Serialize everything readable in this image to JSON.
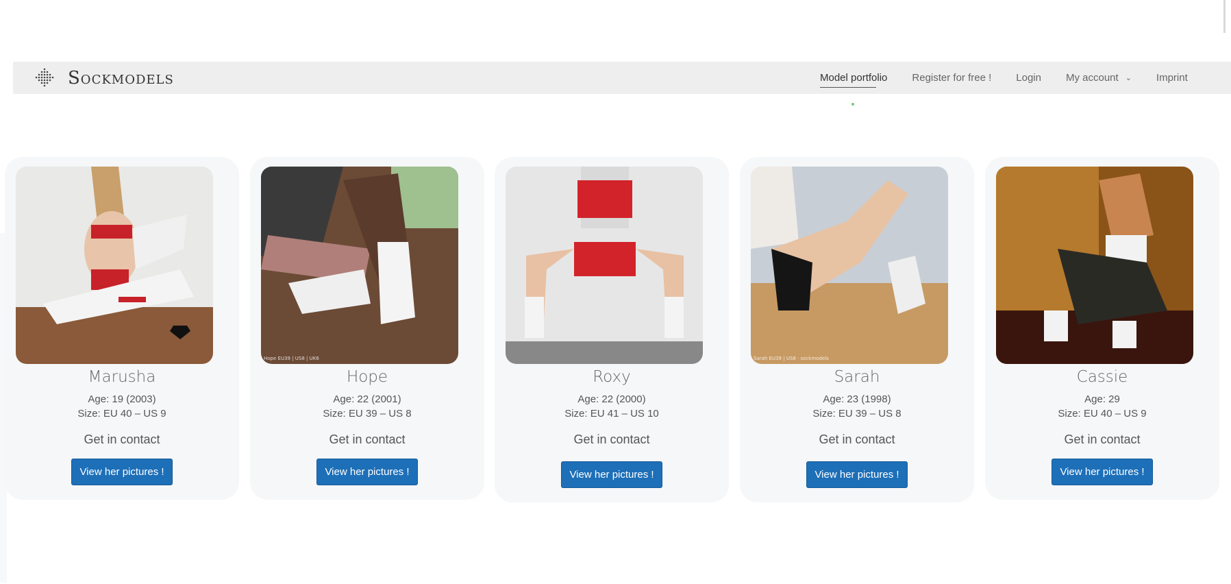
{
  "header": {
    "brand": "Sockmodels",
    "logo_icon": "diamond-dots-logo",
    "nav": [
      {
        "label": "Model portfolio",
        "active": true
      },
      {
        "label": "Register for free !"
      },
      {
        "label": "Login"
      },
      {
        "label": "My account",
        "icon": "chevron-down-icon"
      },
      {
        "label": "Imprint"
      }
    ]
  },
  "colors": {
    "navbar_bg": "#eeeeee",
    "card_bg": "#f5f7f8",
    "button_bg": "#1d6fb8",
    "button_text": "#ffffff"
  },
  "models": [
    {
      "name": "Marusha",
      "age": "Age: 19 (2003)",
      "size": "Size: EU 40 – US 9",
      "contact": "Get in contact",
      "button": "View her pictures !"
    },
    {
      "name": "Hope",
      "age": "Age: 22 (2001)",
      "size": "Size: EU 39 – US 8",
      "contact": "Get in contact",
      "button": "View her pictures !",
      "watermark": "Hope EU39 | US8 | UK6"
    },
    {
      "name": "Roxy",
      "age": "Age: 22 (2000)",
      "size": "Size: EU 41 – US 10",
      "contact": "Get in contact",
      "button": "View her pictures !"
    },
    {
      "name": "Sarah",
      "age": "Age: 23 (1998)",
      "size": "Size: EU 39 – US 8",
      "contact": "Get in contact",
      "button": "View her pictures !",
      "watermark": "Sarah EU39 | US8 · sockmodels"
    },
    {
      "name": "Cassie",
      "age": "Age: 29",
      "size": "Size: EU 40 – US 9",
      "contact": "Get in contact",
      "button": "View her pictures !"
    }
  ]
}
